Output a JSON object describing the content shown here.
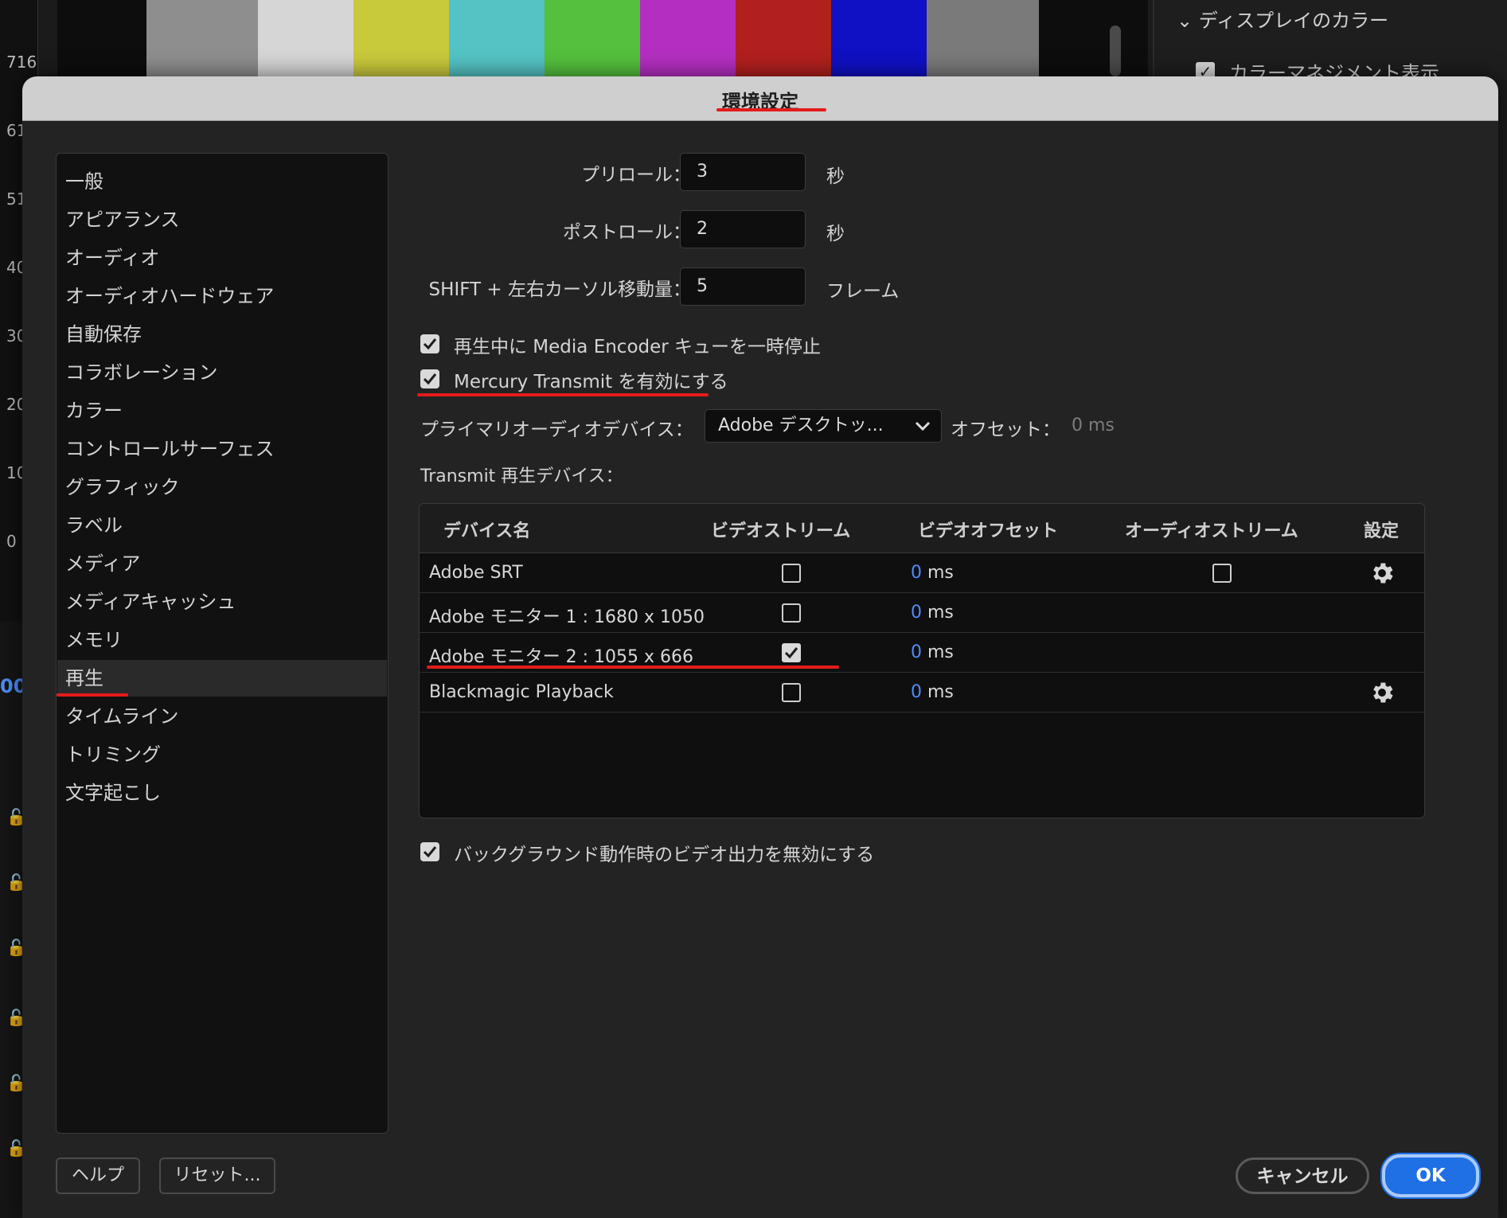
{
  "background": {
    "ruler_numbers": [
      "716",
      "61",
      "51",
      "40",
      "30",
      "20",
      "10",
      "0"
    ],
    "color_bars": [
      "#8e8e8e",
      "#d6d6d6",
      "#c9c93c",
      "#55c3c3",
      "#54c03d",
      "#b42fc1",
      "#b21f1f",
      "#1010c4",
      "#7a7a7a"
    ],
    "right_panel_title": "ディスプレイのカラー",
    "right_panel_checkbox": "カラーマネジメント表示",
    "timecode_fragment": "00"
  },
  "dialog": {
    "title": "環境設定"
  },
  "sidebar": {
    "items": [
      {
        "label": "一般"
      },
      {
        "label": "アピアランス"
      },
      {
        "label": "オーディオ"
      },
      {
        "label": "オーディオハードウェア"
      },
      {
        "label": "自動保存"
      },
      {
        "label": "コラボレーション"
      },
      {
        "label": "カラー"
      },
      {
        "label": "コントロールサーフェス"
      },
      {
        "label": "グラフィック"
      },
      {
        "label": "ラベル"
      },
      {
        "label": "メディア"
      },
      {
        "label": "メディアキャッシュ"
      },
      {
        "label": "メモリ"
      },
      {
        "label": "再生"
      },
      {
        "label": "タイムライン"
      },
      {
        "label": "トリミング"
      },
      {
        "label": "文字起こし"
      }
    ],
    "active": "再生"
  },
  "playback": {
    "preroll_label": "プリロール：",
    "preroll_value": "3",
    "preroll_unit": "秒",
    "postroll_label": "ポストロール：",
    "postroll_value": "2",
    "postroll_unit": "秒",
    "shift_label": "SHIFT + 左右カーソル移動量：",
    "shift_value": "5",
    "shift_unit": "フレーム",
    "pause_media_encoder_label": "再生中に Media Encoder キューを一時停止",
    "pause_media_encoder_checked": true,
    "mercury_transmit_label": "Mercury Transmit を有効にする",
    "mercury_transmit_checked": true,
    "primary_audio_label": "プライマリオーディオデバイス：",
    "primary_audio_value": "Adobe デスクトッ...",
    "offset_label": "オフセット：",
    "offset_value": "0 ms",
    "transmit_devices_label": "Transmit 再生デバイス：",
    "disable_background_label": "バックグラウンド動作時のビデオ出力を無効にする",
    "disable_background_checked": true
  },
  "device_table": {
    "headers": [
      "デバイス名",
      "ビデオストリーム",
      "ビデオオフセット",
      "オーディオストリーム",
      "設定"
    ],
    "rows": [
      {
        "name": "Adobe SRT",
        "video": false,
        "offset_num": "0",
        "offset_unit": " ms",
        "has_audio": true,
        "audio": false,
        "has_settings": true
      },
      {
        "name": "Adobe モニター 1 : 1680 x 1050",
        "video": false,
        "offset_num": "0",
        "offset_unit": " ms",
        "has_audio": false,
        "audio": false,
        "has_settings": false
      },
      {
        "name": "Adobe モニター 2 : 1055 x 666",
        "video": true,
        "offset_num": "0",
        "offset_unit": " ms",
        "has_audio": false,
        "audio": false,
        "has_settings": false
      },
      {
        "name": "Blackmagic Playback",
        "video": false,
        "offset_num": "0",
        "offset_unit": " ms",
        "has_audio": false,
        "audio": false,
        "has_settings": true
      }
    ]
  },
  "buttons": {
    "help": "ヘルプ",
    "reset": "リセット...",
    "cancel": "キャンセル",
    "ok": "OK"
  },
  "colors": {
    "accent_blue": "#1f6fe5",
    "annotation_red": "#e51b1b"
  }
}
